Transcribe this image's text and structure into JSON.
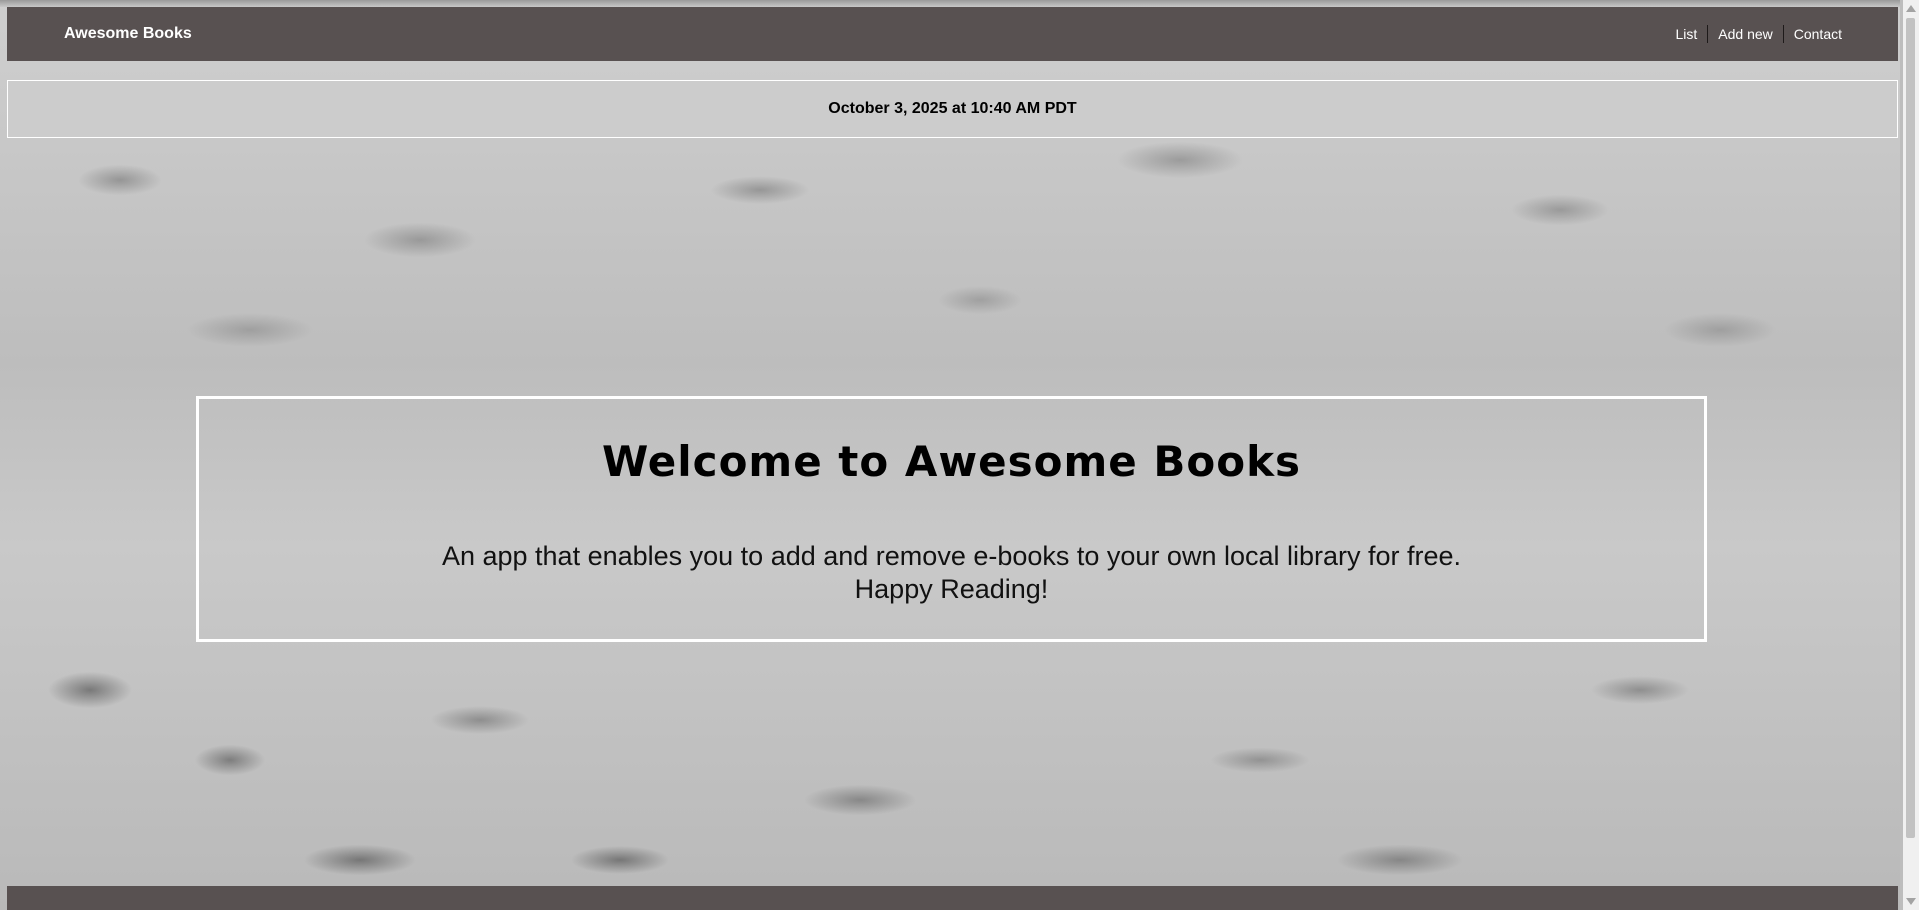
{
  "header": {
    "brand": "Awesome Books",
    "nav": [
      {
        "label": "List"
      },
      {
        "label": "Add new"
      },
      {
        "label": "Contact"
      }
    ]
  },
  "date_bar": {
    "text": "October 3, 2025 at 10:40 AM PDT"
  },
  "welcome": {
    "title": "Welcome to Awesome Books",
    "description_line1": "An app that enables you to add and remove e-books to your own local library for free.",
    "description_line2": "Happy Reading!"
  },
  "colors": {
    "navbar": "#585151",
    "date_bar": "#cccccc",
    "box_border": "#ffffff"
  },
  "icons": {
    "scroll_up": "triangle-up-icon",
    "scroll_down": "triangle-down-icon"
  }
}
